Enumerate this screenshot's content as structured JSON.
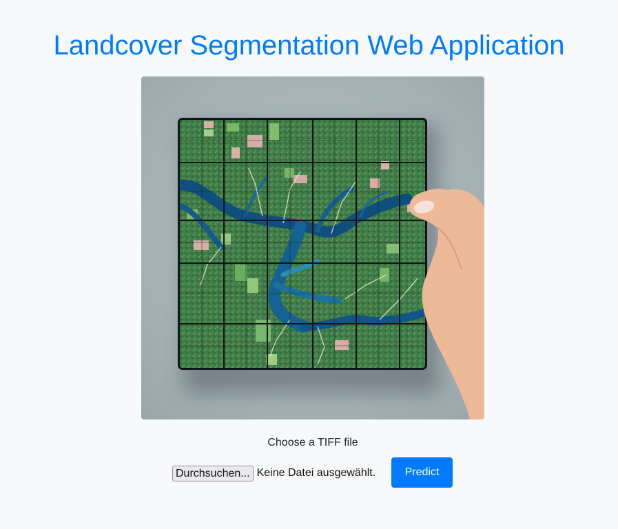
{
  "page": {
    "title": "Landcover Segmentation Web Application"
  },
  "upload": {
    "label": "Choose a TIFF file",
    "browse_label": "Durchsuchen...",
    "file_status": "Keine Datei ausgewählt.",
    "predict_label": "Predict"
  },
  "colors": {
    "accent": "#007bff",
    "background": "#f8f9fa"
  }
}
